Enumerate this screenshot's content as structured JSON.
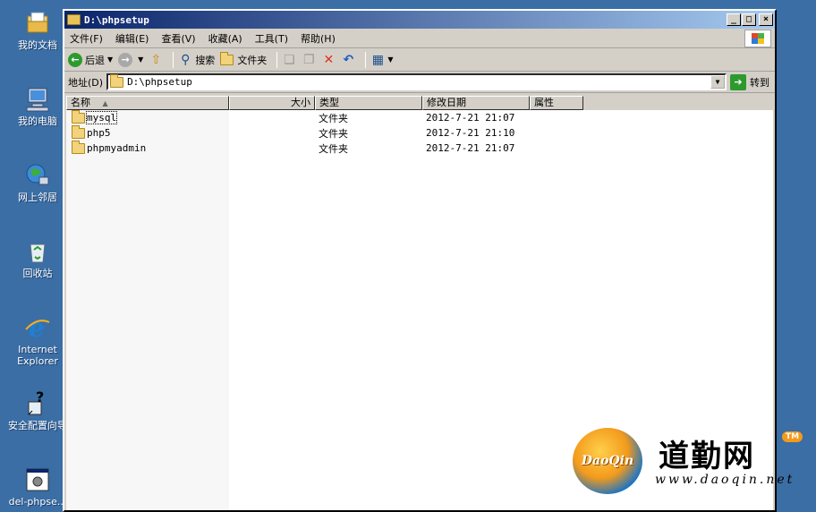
{
  "desktop": {
    "icons": [
      {
        "label": "我的文档",
        "icon": "my-documents-icon"
      },
      {
        "label": "我的电脑",
        "icon": "my-computer-icon"
      },
      {
        "label": "网上邻居",
        "icon": "network-places-icon"
      },
      {
        "label": "回收站",
        "icon": "recycle-bin-icon"
      },
      {
        "label": "Internet\nExplorer",
        "line1": "Internet",
        "line2": "Explorer",
        "icon": "internet-explorer-icon"
      },
      {
        "label": "安全配置向导",
        "icon": "security-wizard-icon"
      },
      {
        "label": "del-phpse...",
        "icon": "batch-file-icon"
      }
    ]
  },
  "window": {
    "title": "D:\\phpsetup",
    "controls": {
      "minimize": "_",
      "maximize": "□",
      "close": "×"
    }
  },
  "menubar": {
    "items": [
      "文件(F)",
      "编辑(E)",
      "查看(V)",
      "收藏(A)",
      "工具(T)",
      "帮助(H)"
    ]
  },
  "toolbar": {
    "back_label": "后退",
    "search_label": "搜索",
    "folders_label": "文件夹"
  },
  "addressbar": {
    "label": "地址(D)",
    "value": "D:\\phpsetup",
    "go_label": "转到"
  },
  "listview": {
    "columns": [
      "名称",
      "大小",
      "类型",
      "修改日期",
      "属性"
    ],
    "rows": [
      {
        "name": "mysql",
        "size": "",
        "type": "文件夹",
        "modified": "2012-7-21 21:07",
        "attr": ""
      },
      {
        "name": "php5",
        "size": "",
        "type": "文件夹",
        "modified": "2012-7-21 21:10",
        "attr": ""
      },
      {
        "name": "phpmyadmin",
        "size": "",
        "type": "文件夹",
        "modified": "2012-7-21 21:07",
        "attr": ""
      }
    ]
  },
  "watermark": {
    "logo_text": "DaoQin",
    "brand": "道勤网",
    "tm": "TM",
    "url": "www.daoqin.net"
  },
  "colors": {
    "desktop_bg": "#3a6ea5",
    "title_start": "#0a246a",
    "title_end": "#a6caf0",
    "window_face": "#d4d0c8"
  }
}
